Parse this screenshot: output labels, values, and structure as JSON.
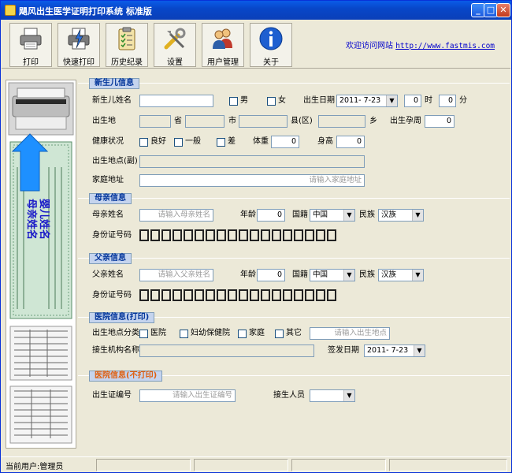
{
  "window": {
    "title": "飓风出生医学证明打印系统 标准版",
    "min_glyph": "_",
    "max_glyph": "□",
    "close_glyph": "✕"
  },
  "toolbar": {
    "buttons": [
      {
        "label": "打印",
        "icon": "printer-icon"
      },
      {
        "label": "快速打印",
        "icon": "quick-print-icon"
      },
      {
        "label": "历史纪录",
        "icon": "clipboard-icon"
      },
      {
        "label": "设置",
        "icon": "tools-icon"
      },
      {
        "label": "用户管理",
        "icon": "users-icon"
      },
      {
        "label": "关于",
        "icon": "info-icon"
      }
    ],
    "visit_text": "欢迎访问网站",
    "visit_url": "http://www.fastmis.com"
  },
  "newborn": {
    "title": "新生儿信息",
    "name_label": "新生儿姓名",
    "male": "男",
    "female": "女",
    "birthdate_label": "出生日期",
    "birthdate": "2011- 7-23",
    "hour_value": "0",
    "hour_label": "时",
    "minute_value": "0",
    "minute_label": "分",
    "birthplace_label": "出生地",
    "province": "省",
    "city": "市",
    "county": "县(区)",
    "township": "乡",
    "gest_label": "出生孕周",
    "gest_value": "0",
    "health_label": "健康状况",
    "health_good": "良好",
    "health_normal": "一般",
    "health_poor": "差",
    "weight_label": "体重",
    "weight_value": "0",
    "height_label": "身高",
    "height_value": "0",
    "birthplace2_label": "出生地点(副)",
    "address_label": "家庭地址",
    "address_placeholder": "请输入家庭地址"
  },
  "mother": {
    "title": "母亲信息",
    "name_label": "母亲姓名",
    "name_placeholder": "请输入母亲姓名",
    "age_label": "年龄",
    "age_value": "0",
    "nation_label": "国籍",
    "nation_value": "中国",
    "ethnic_label": "民族",
    "ethnic_value": "汉族",
    "id_label": "身份证号码"
  },
  "father": {
    "title": "父亲信息",
    "name_label": "父亲姓名",
    "name_placeholder": "请输入父亲姓名",
    "age_label": "年龄",
    "age_value": "0",
    "nation_label": "国籍",
    "nation_value": "中国",
    "ethnic_label": "民族",
    "ethnic_value": "汉族",
    "id_label": "身份证号码"
  },
  "hospital_print": {
    "title": "医院信息(打印)",
    "category_label": "出生地点分类",
    "opt_hospital": "医院",
    "opt_maternal": "妇幼保健院",
    "opt_home": "家庭",
    "opt_other": "其它",
    "place_placeholder": "请输入出生地点",
    "agency_label": "接生机构名称",
    "issue_label": "签发日期",
    "issue_date": "2011- 7-23"
  },
  "hospital_noprint": {
    "title": "医院信息(不打印)",
    "cert_label": "出生证编号",
    "cert_placeholder": "请输入出生证编号",
    "midwife_label": "接生人员"
  },
  "status": {
    "text": "当前用户:管理员"
  },
  "preview": {
    "text_line1": "婴儿姓名",
    "text_line2": "母亲姓名"
  },
  "colors": {
    "group_title": "#003399",
    "noprint_title": "#E06010",
    "link": "#0000CC",
    "arrow": "#1E90FF"
  }
}
